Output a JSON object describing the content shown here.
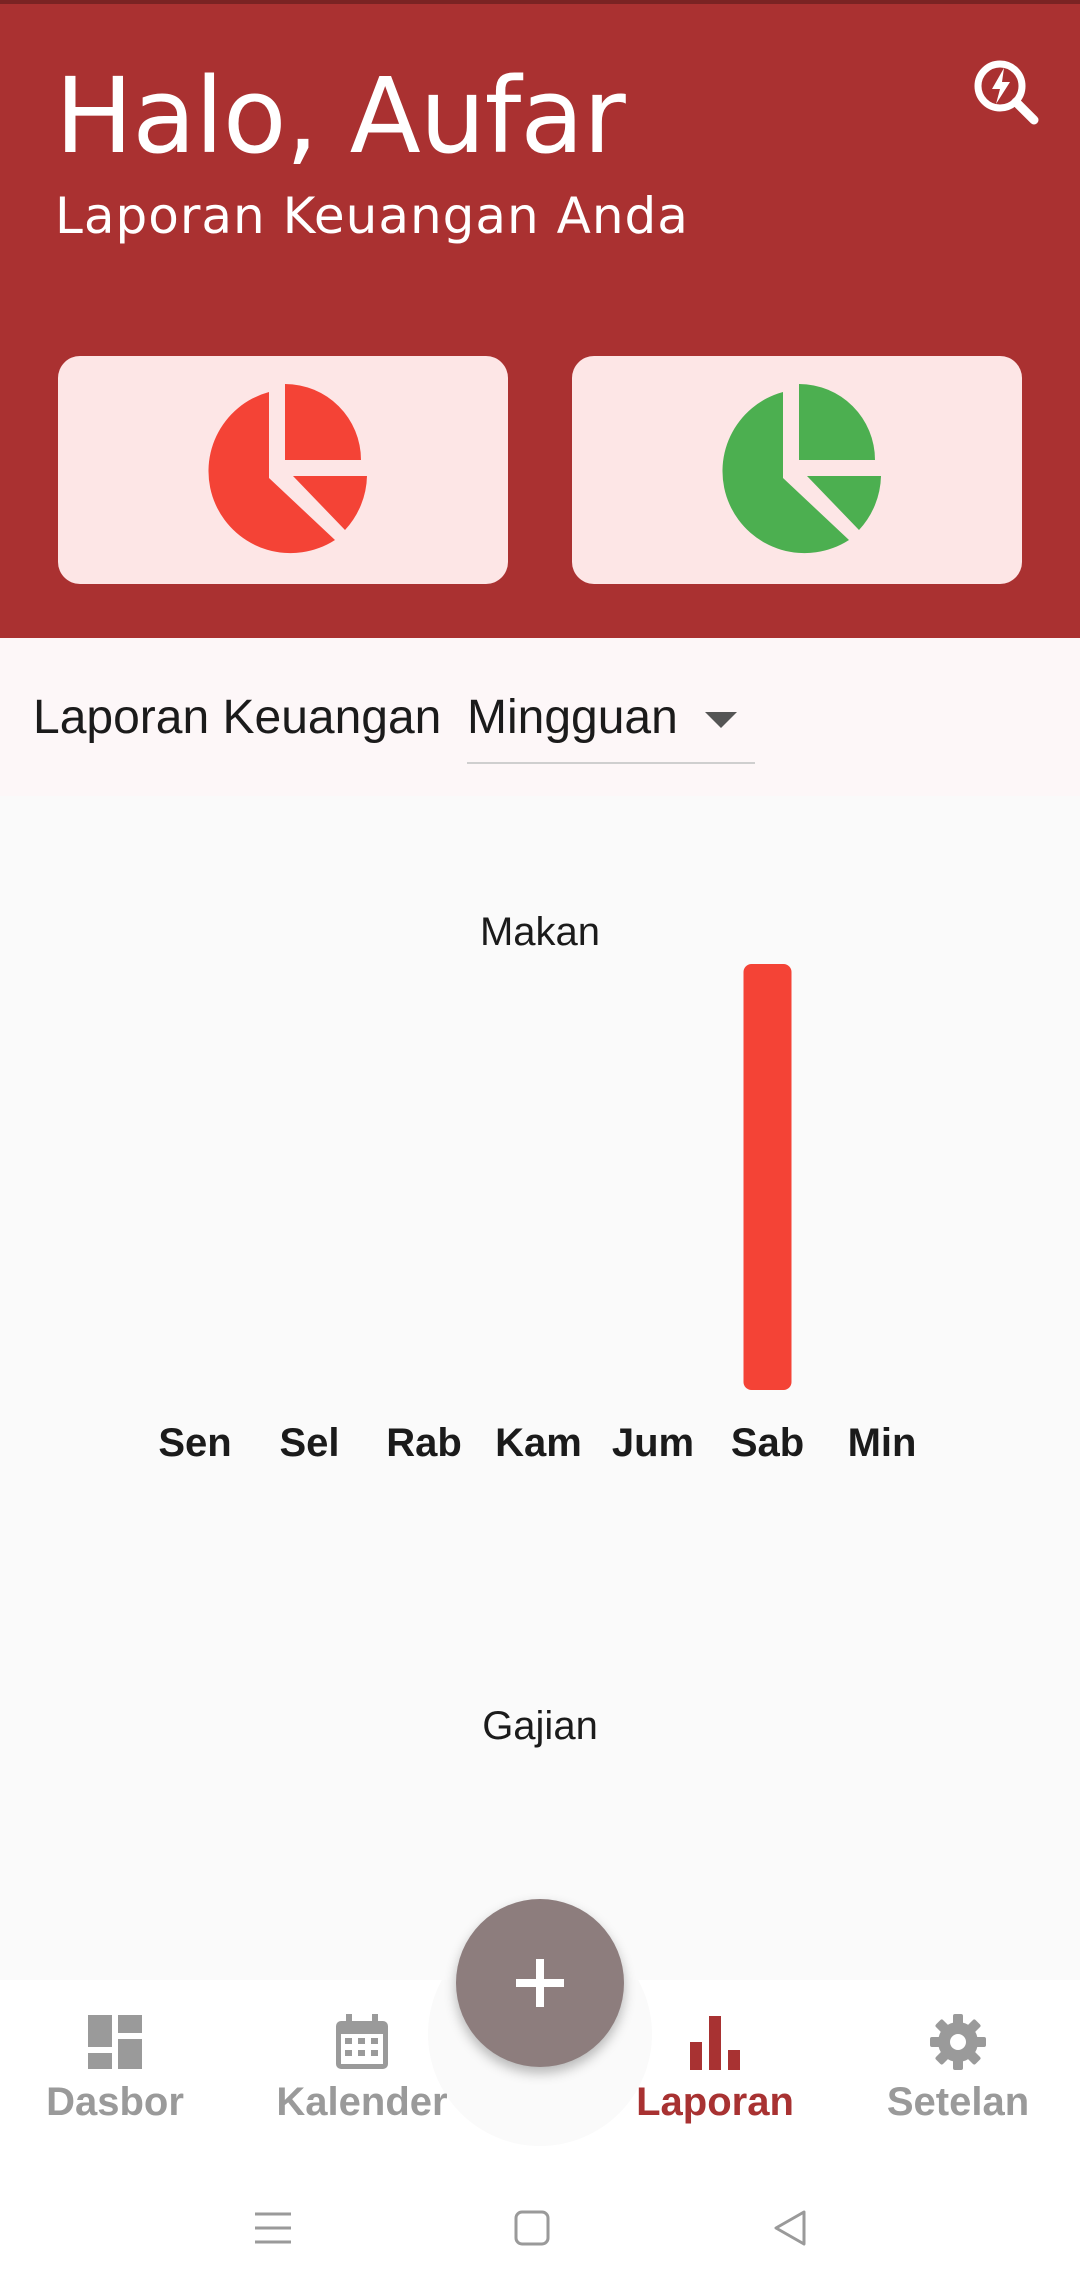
{
  "header": {
    "greeting": "Halo, Aufar",
    "subtitle": "Laporan Keuangan Anda",
    "search_icon": "search-lightning-icon",
    "background_color": "#aa3131"
  },
  "summary_cards": [
    {
      "icon": "pie-chart-icon",
      "color": "#f44336"
    },
    {
      "icon": "pie-chart-icon",
      "color": "#4caf50"
    }
  ],
  "report": {
    "label": "Laporan Keuangan",
    "period": "Mingguan"
  },
  "chart_data": [
    {
      "type": "bar",
      "title": "Makan",
      "categories": [
        "Sen",
        "Sel",
        "Rab",
        "Kam",
        "Jum",
        "Sab",
        "Min"
      ],
      "values": [
        0,
        0,
        0,
        0,
        0,
        1,
        0
      ],
      "color": "#f44336",
      "grid": false
    },
    {
      "type": "bar",
      "title": "Gajian",
      "categories": [],
      "values": [],
      "grid": false
    }
  ],
  "fab": {
    "icon": "plus-icon",
    "color": "#8d7d7d"
  },
  "bottom_nav": [
    {
      "label": "Dasbor",
      "icon": "dashboard-icon",
      "active": false
    },
    {
      "label": "Kalender",
      "icon": "calendar-icon",
      "active": false
    },
    {
      "label": "Laporan",
      "icon": "bar-chart-icon",
      "active": true
    },
    {
      "label": "Setelan",
      "icon": "settings-gear-icon",
      "active": false
    }
  ],
  "accent_color": "#a83232",
  "system_nav": [
    "menu-icon",
    "home-icon",
    "back-icon"
  ]
}
